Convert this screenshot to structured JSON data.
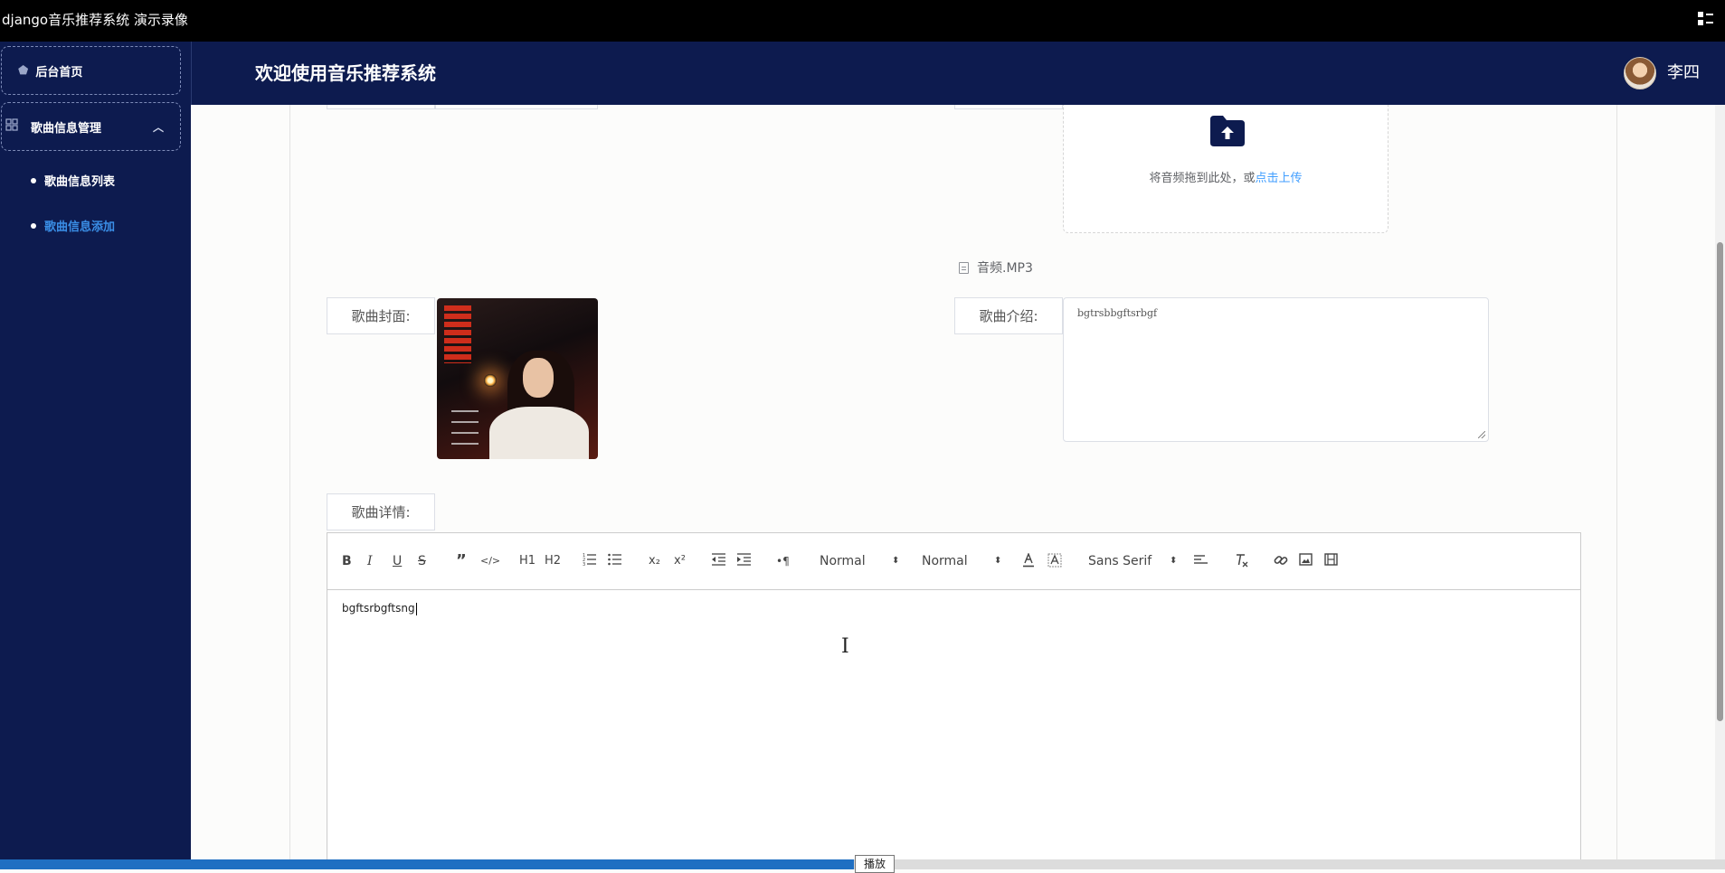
{
  "window": {
    "title": "django音乐推荐系统 演示录像"
  },
  "sidebar": {
    "items": [
      {
        "label": "后台首页",
        "icon": "home-icon"
      },
      {
        "label": "歌曲信息管理",
        "icon": "grid-icon",
        "expanded": true,
        "children": [
          {
            "label": "歌曲信息列表",
            "active": false
          },
          {
            "label": "歌曲信息添加",
            "active": true
          }
        ]
      }
    ]
  },
  "header": {
    "title": "欢迎使用音乐推荐系统",
    "user_name": "李四"
  },
  "form": {
    "upload": {
      "text": "将音频拖到此处，或",
      "link_text": "点击上传"
    },
    "uploaded_file": "音频.MP3",
    "cover_label": "歌曲封面:",
    "intro_label": "歌曲介绍:",
    "intro_value": "bgtrsbbgftsrbgf",
    "detail_label": "歌曲详情:"
  },
  "editor": {
    "toolbar": {
      "bold": "B",
      "italic": "I",
      "underline": "U",
      "strike": "S",
      "blockquote": "”",
      "code": "</>",
      "h1": "H1",
      "h2": "H2",
      "sub": "x₂",
      "sup": "x²",
      "direction": "•¶",
      "size_value": "Normal",
      "header_value": "Normal",
      "font_value": "Sans Serif"
    },
    "content": "bgftsrbgftsng"
  },
  "player": {
    "tooltip": "播放",
    "progress": 0.495
  },
  "colors": {
    "navy": "#0d1b4f",
    "accent": "#3a8ee6",
    "link": "#409eff"
  }
}
